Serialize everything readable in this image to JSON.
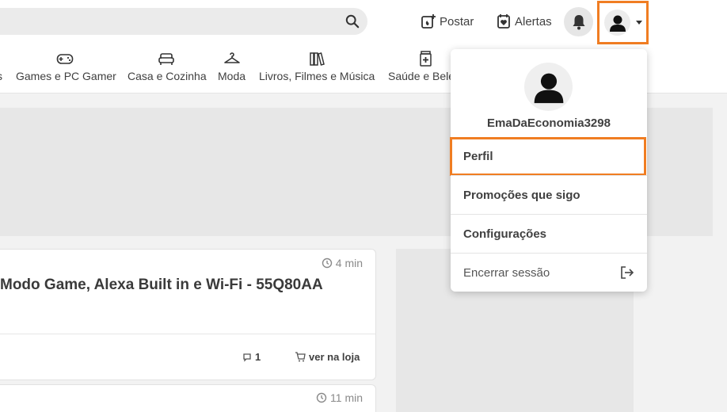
{
  "colors": {
    "accent_orange": "#f07d22",
    "header_bg": "#ffffff",
    "page_bg": "#f2f2f2"
  },
  "header": {
    "search": {
      "placeholder": "",
      "icon": "search-icon"
    },
    "post_label": "Postar",
    "alerts_label": "Alertas"
  },
  "categories": [
    {
      "label": "s",
      "icon": ""
    },
    {
      "label": "Games e PC Gamer",
      "icon": "gamepad-icon"
    },
    {
      "label": "Casa e Cozinha",
      "icon": "sofa-icon"
    },
    {
      "label": "Moda",
      "icon": "hanger-icon"
    },
    {
      "label": "Livros, Filmes e Música",
      "icon": "books-icon"
    },
    {
      "label": "Saúde e Bele",
      "icon": "pharmacy-icon"
    }
  ],
  "deals": [
    {
      "time": "4 min",
      "title": "Modo Game, Alexa Built in e Wi-Fi - 55Q80AA",
      "comments": "1",
      "store_label": "ver na loja"
    },
    {
      "time": "11 min"
    }
  ],
  "user_menu": {
    "username": "EmaDaEconomia3298",
    "items": [
      {
        "label": "Perfil"
      },
      {
        "label": "Promoções que sigo"
      },
      {
        "label": "Configurações"
      },
      {
        "label": "Encerrar sessão"
      }
    ]
  }
}
